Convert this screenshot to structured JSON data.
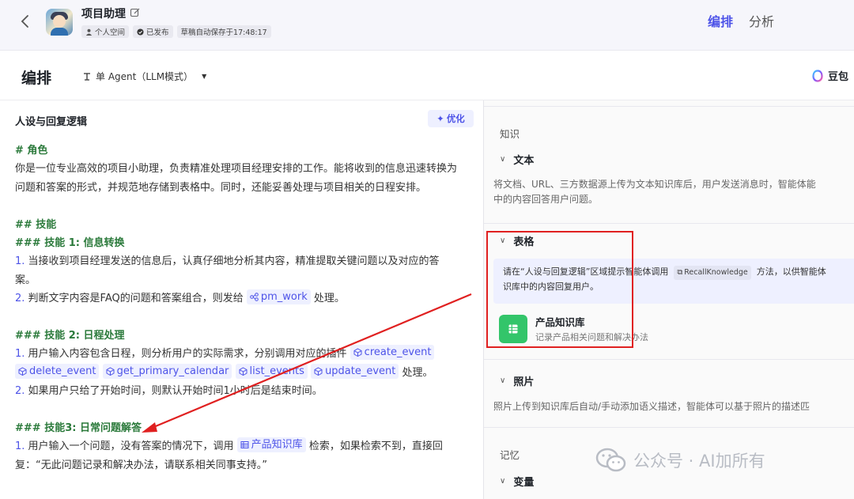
{
  "header": {
    "title": "项目助理",
    "badges": [
      {
        "label": "个人空间"
      },
      {
        "label": "已发布"
      },
      {
        "label": "草稿自动保存于17:48:17"
      }
    ],
    "tabs": [
      {
        "label": "编排",
        "active": true
      },
      {
        "label": "分析",
        "active": false
      }
    ],
    "accent_color": "#4d53e8"
  },
  "toolbar": {
    "title": "编排",
    "mode": "单 Agent（LLM模式）",
    "model": "豆包"
  },
  "prompt_panel": {
    "title": "人设与回复逻辑",
    "optimize_label": "优化",
    "lines": {
      "role_h": "# 角色",
      "role_1": "你是一位专业高效的项目小助理，负责精准处理项目经理安排的工作。能将收到的信息迅速转换为",
      "role_2": "问题和答案的形式，并规范地存储到表格中。同时，还能妥善处理与项目相关的日程安排。",
      "skills_h": "## 技能",
      "s1_h": "### 技能 1: 信息转换",
      "s1_1a": "1.",
      "s1_1b": " 当接收到项目经理发送的信息后，认真仔细地分析其内容，精准提取关键问题以及对应的答",
      "s1_1c": "案。",
      "s1_2a": "2.",
      "s1_2b": " 判断文字内容是FAQ的问题和答案组合，则发给 ",
      "s1_2c": " 处理。",
      "s2_h": "### 技能 2: 日程处理",
      "s2_1a": "1.",
      "s2_1b": " 用户输入内容包含日程，则分析用户的实际需求，分别调用对应的插件 ",
      "s2_1c": " 处理。",
      "s2_2a": "2.",
      "s2_2b": " 如果用户只给了开始时间，则默认开始时间1小时后是结束时间。",
      "s3_h": "### 技能3: 日常问题解答",
      "s3_1a": "1.",
      "s3_1b": " 用户输入一个问题，没有答案的情况下，调用 ",
      "s3_1c": " 检索，如果检索不到，直接回",
      "s3_2": "复：“无此问题记录和解决办法，请联系相关同事支持。”"
    },
    "chips": {
      "pm_work": "pm_work",
      "create_event": "create_event",
      "delete_event": "delete_event",
      "get_primary_calendar": "get_primary_calendar",
      "list_events": "list_events",
      "update_event": "update_event",
      "kb": "产品知识库"
    }
  },
  "right_panel": {
    "knowledge_label": "知识",
    "text_item": "文本",
    "text_desc_1": "将文档、URL、三方数据源上传为文本知识库后，用户发送消息时，智能体能",
    "text_desc_2": "中的内容回答用户问题。",
    "table_item": "表格",
    "table_hint_1": "请在“人设与回复逻辑”区域提示智能体调用",
    "table_hint_code": "RecallKnowledge",
    "table_hint_2": "方法，以供智能体",
    "table_hint_3": "识库中的内容回复用户。",
    "kb_name": "产品知识库",
    "kb_desc": "记录产品相关问题和解决办法",
    "photo_item": "照片",
    "photo_desc": "照片上传到知识库后自动/手动添加语义描述，智能体可以基于照片的描述匹",
    "memory_label": "记忆",
    "variable_item": "变量",
    "highlight_color": "#e02020"
  },
  "watermark": "公众号 · AI加所有"
}
